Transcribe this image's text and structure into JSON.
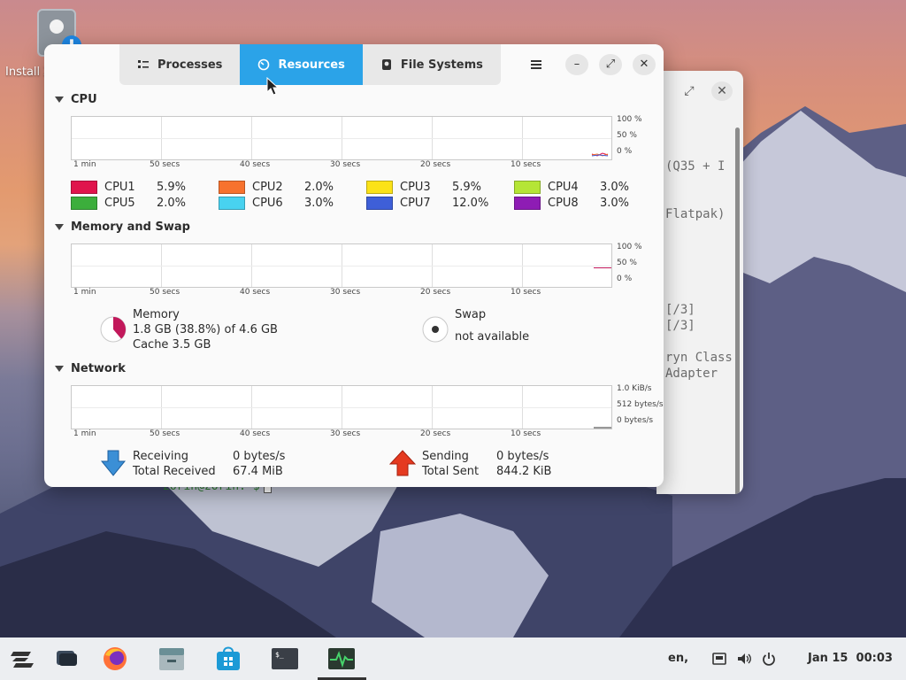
{
  "desktop": {
    "icon_label": "Install Z",
    "terminal": {
      "lines": [
        "(Q35 + I",
        "Flatpak)",
        "[/3]",
        "[/3]",
        "ryn Class",
        "Adapter"
      ],
      "prompt": "zorin@zorin:~$"
    }
  },
  "window": {
    "tabs": [
      {
        "label": "Processes",
        "icon": "processes-list-icon"
      },
      {
        "label": "Resources",
        "icon": "resources-gauge-icon",
        "active": true
      },
      {
        "label": "File Systems",
        "icon": "file-systems-drive-icon"
      }
    ],
    "buttons": {
      "menu": "hamburger-menu-icon",
      "minimize": "minimize-icon",
      "maximize": "maximize-icon",
      "close": "close-icon"
    },
    "cpu": {
      "title": "CPU",
      "x_labels": [
        "1 min",
        "50 secs",
        "40 secs",
        "30 secs",
        "20 secs",
        "10 secs"
      ],
      "y_labels": [
        "100 %",
        "50 %",
        "0 %"
      ],
      "cores": [
        {
          "name": "CPU1",
          "percent": "5.9%",
          "color": "#e0144c"
        },
        {
          "name": "CPU2",
          "percent": "2.0%",
          "color": "#f7722e"
        },
        {
          "name": "CPU3",
          "percent": "5.9%",
          "color": "#fbe218"
        },
        {
          "name": "CPU4",
          "percent": "3.0%",
          "color": "#b5e536"
        },
        {
          "name": "CPU5",
          "percent": "2.0%",
          "color": "#3cae3c"
        },
        {
          "name": "CPU6",
          "percent": "3.0%",
          "color": "#48d2f0"
        },
        {
          "name": "CPU7",
          "percent": "12.0%",
          "color": "#3e5fd8"
        },
        {
          "name": "CPU8",
          "percent": "3.0%",
          "color": "#8e1cb4"
        }
      ]
    },
    "memory": {
      "title": "Memory and Swap",
      "x_labels": [
        "1 min",
        "50 secs",
        "40 secs",
        "30 secs",
        "20 secs",
        "10 secs"
      ],
      "y_labels": [
        "100 %",
        "50 %",
        "0 %"
      ],
      "memory_label": "Memory",
      "memory_usage": "1.8 GB (38.8%) of 4.6 GB",
      "memory_fraction": 0.388,
      "cache": "Cache 3.5 GB",
      "swap_label": "Swap",
      "swap_status": "not available",
      "color": "#c2185b"
    },
    "network": {
      "title": "Network",
      "x_labels": [
        "1 min",
        "50 secs",
        "40 secs",
        "30 secs",
        "20 secs",
        "10 secs"
      ],
      "y_labels": [
        "1.0 KiB/s",
        "512 bytes/s",
        "0 bytes/s"
      ],
      "receiving_label": "Receiving",
      "receiving_rate": "0 bytes/s",
      "total_received_label": "Total Received",
      "total_received": "67.4 MiB",
      "sending_label": "Sending",
      "sending_rate": "0 bytes/s",
      "total_sent_label": "Total Sent",
      "total_sent": "844.2 KiB"
    }
  },
  "taskbar": {
    "apps": [
      "zorin-menu-icon",
      "workspaces-icon",
      "firefox-icon",
      "files-icon",
      "software-store-icon",
      "terminal-icon",
      "system-monitor-icon"
    ],
    "keyboard_layout": "en,",
    "date": "Jan 15",
    "time": "00:03"
  }
}
